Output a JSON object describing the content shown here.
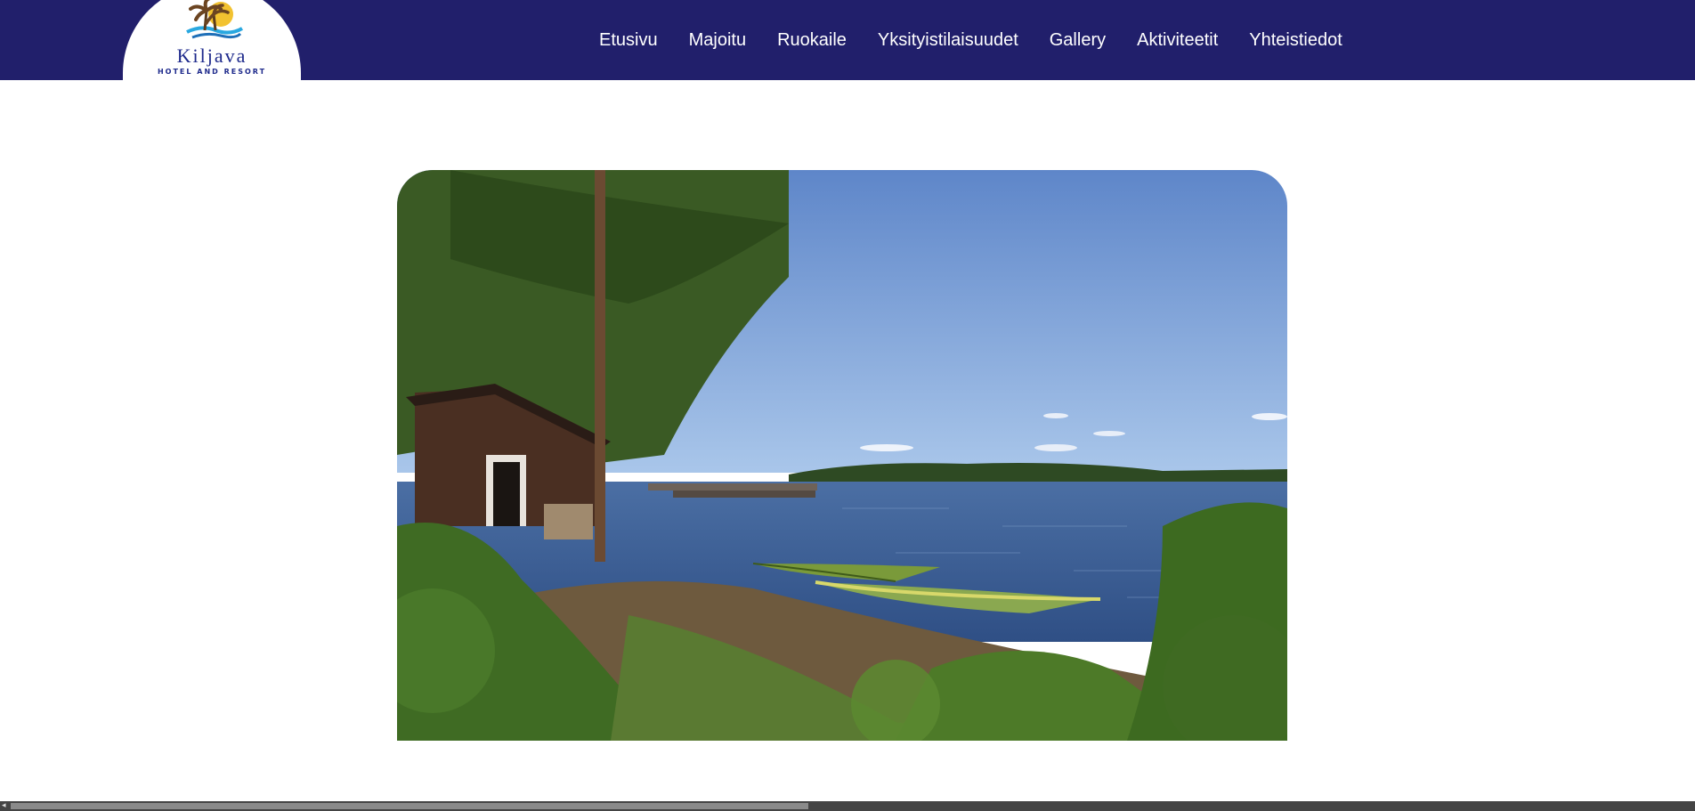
{
  "header": {
    "logo": {
      "name": "Kiljava",
      "subtitle": "HOTEL AND RESORT",
      "icon": "palm-tree-sun-wave-icon"
    },
    "nav": [
      {
        "label": "Etusivu"
      },
      {
        "label": "Majoitu"
      },
      {
        "label": "Ruokaile"
      },
      {
        "label": "Yksityistilaisuudet"
      },
      {
        "label": "Gallery"
      },
      {
        "label": "Aktiviteetit"
      },
      {
        "label": "Yhteistiedot"
      }
    ]
  },
  "colors": {
    "header_bg": "#211f6b",
    "nav_text": "#ffffff",
    "logo_text": "#1e2a8c"
  },
  "hero": {
    "image": "lake-shore-with-cabin-pine-and-rowboats"
  },
  "scrollbar": {
    "orientation": "horizontal"
  }
}
